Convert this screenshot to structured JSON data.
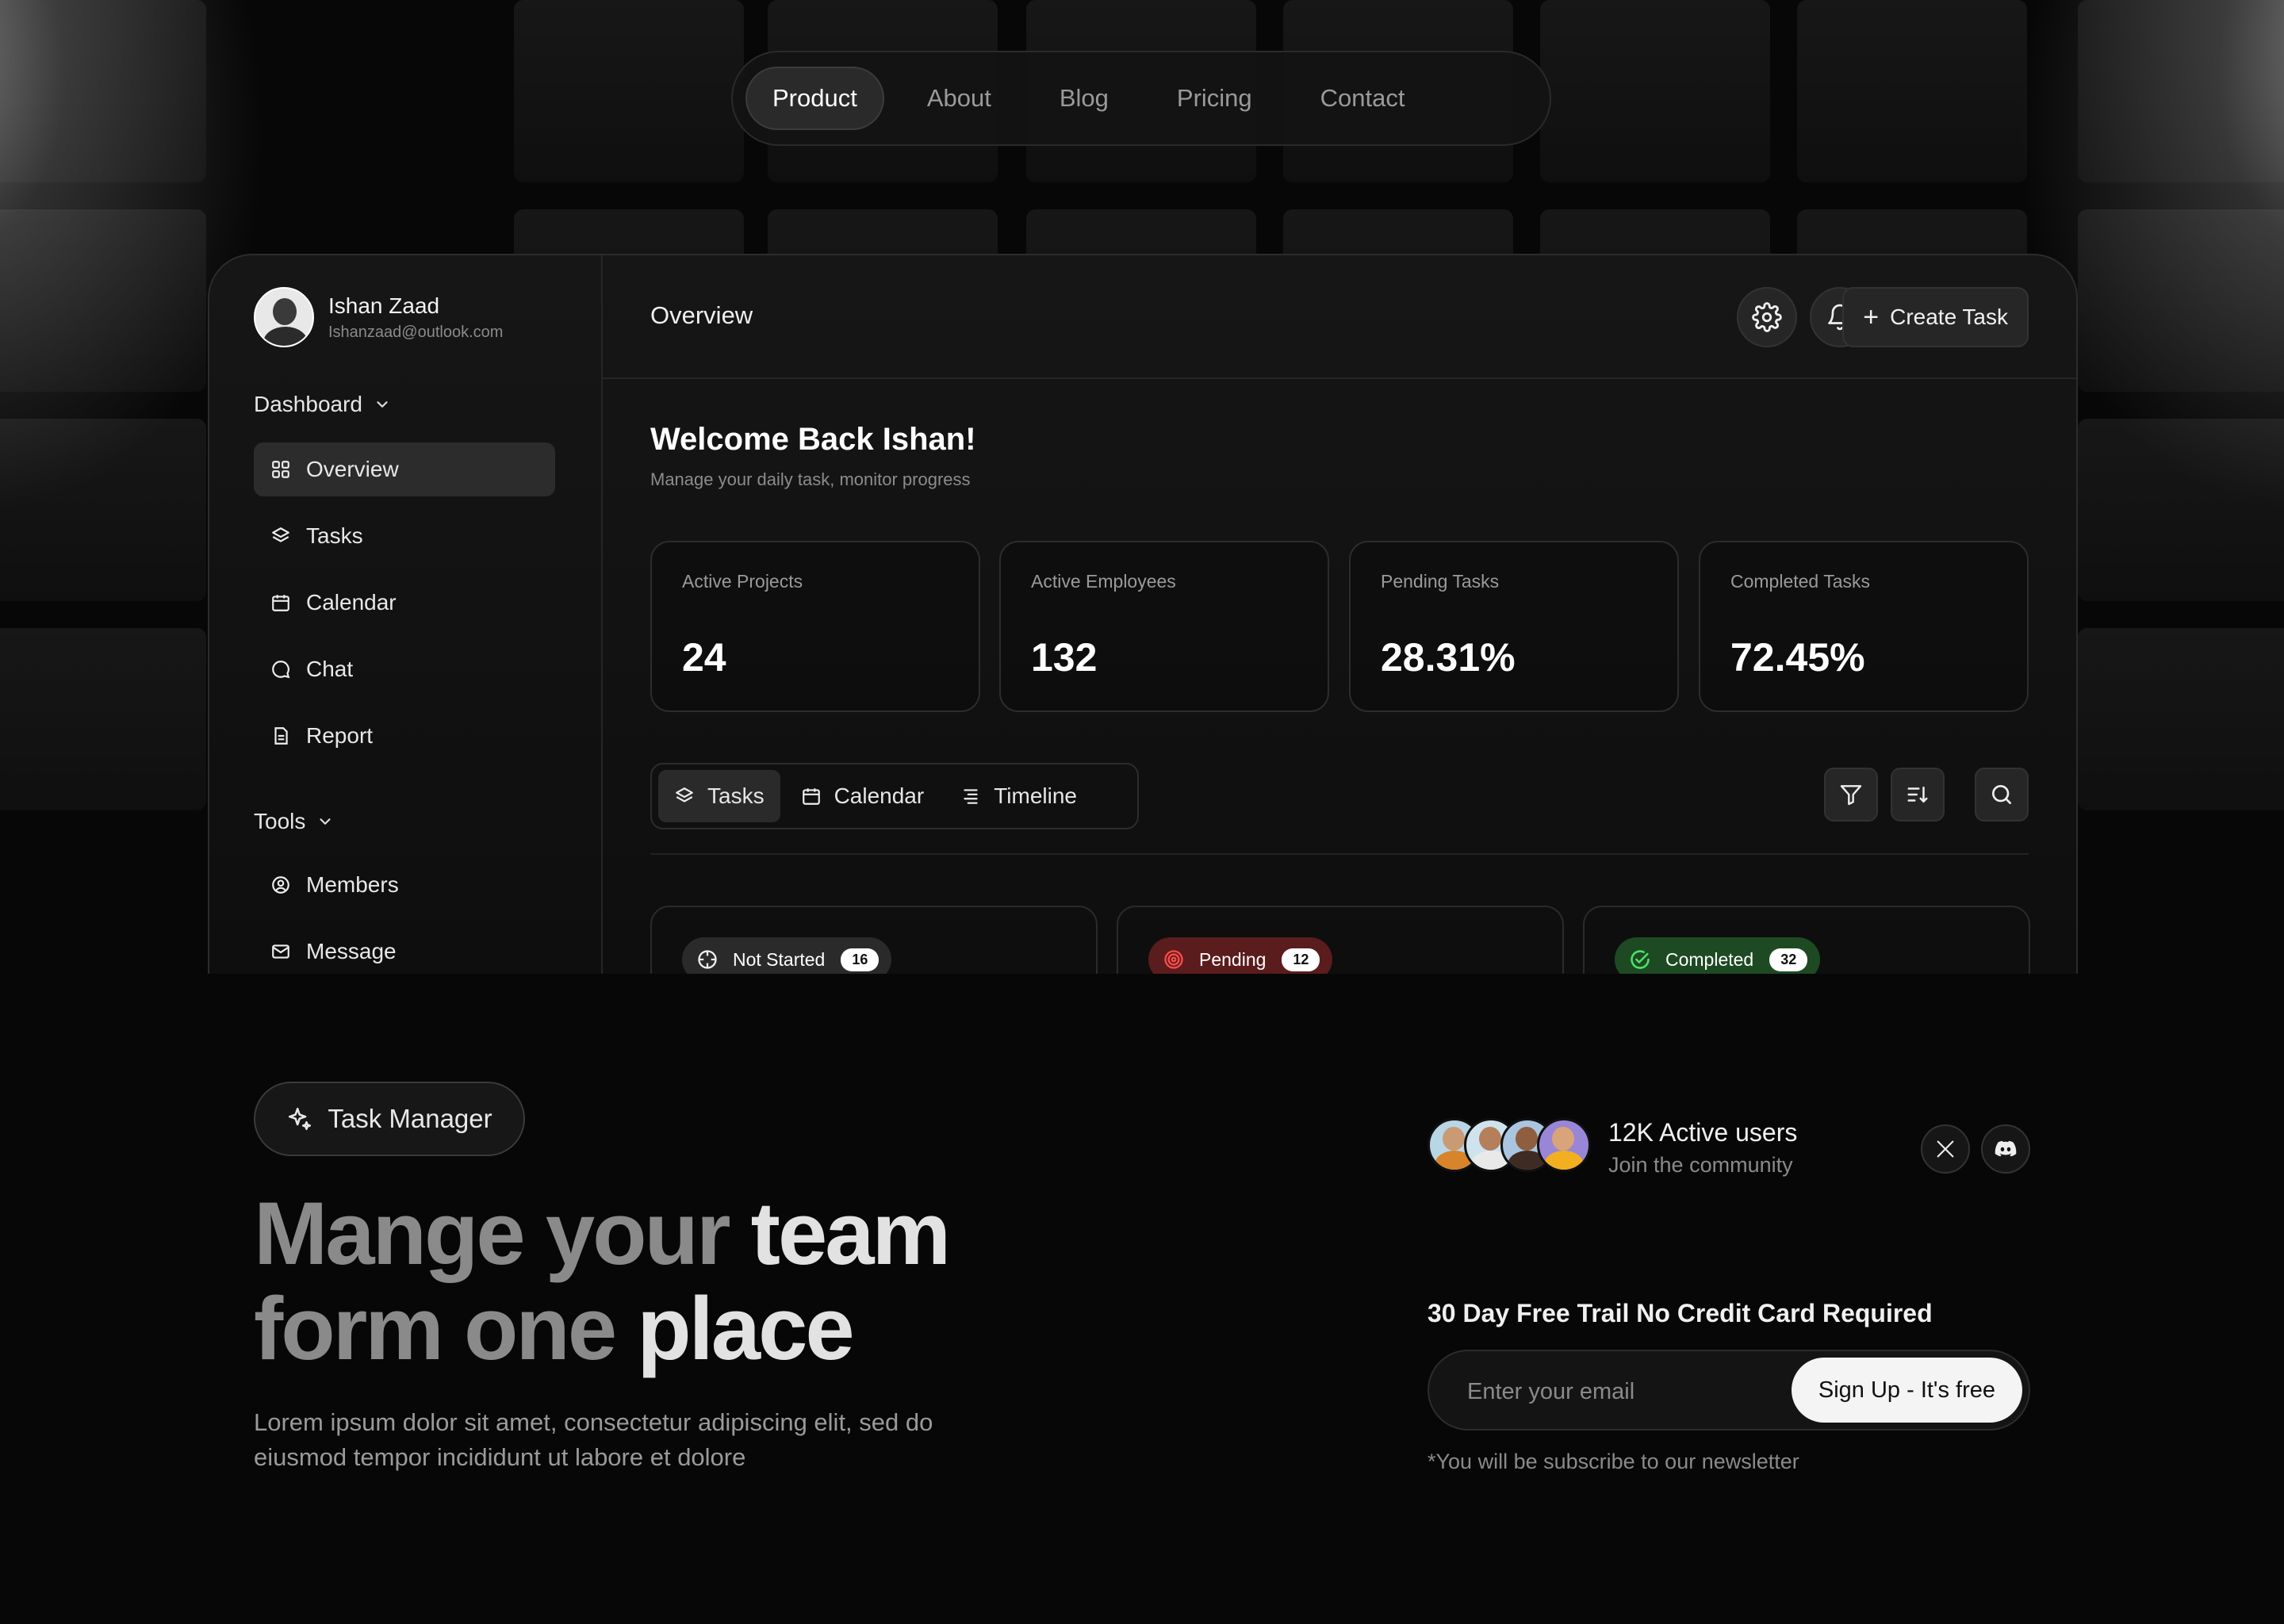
{
  "topnav": {
    "items": [
      "Product",
      "About",
      "Blog",
      "Pricing",
      "Contact"
    ],
    "active": "Product"
  },
  "user": {
    "name": "Ishan Zaad",
    "email": "Ishanzaad@outlook.com"
  },
  "sidebar": {
    "dashboard_label": "Dashboard",
    "dashboard_items": [
      {
        "label": "Overview",
        "icon": "grid-icon",
        "active": true
      },
      {
        "label": "Tasks",
        "icon": "layers-icon"
      },
      {
        "label": "Calendar",
        "icon": "calendar-icon"
      },
      {
        "label": "Chat",
        "icon": "chat-icon"
      },
      {
        "label": "Report",
        "icon": "report-icon"
      }
    ],
    "tools_label": "Tools",
    "tools_items": [
      {
        "label": "Members",
        "icon": "user-circle-icon"
      },
      {
        "label": "Message",
        "icon": "mail-icon"
      }
    ]
  },
  "header": {
    "title": "Overview",
    "create_label": "Create Task"
  },
  "welcome": {
    "title": "Welcome Back Ishan!",
    "subtitle": "Manage your daily task, monitor progress"
  },
  "stats": [
    {
      "label": "Active Projects",
      "value": "24"
    },
    {
      "label": "Active Employees",
      "value": "132"
    },
    {
      "label": "Pending Tasks",
      "value": "28.31%"
    },
    {
      "label": "Completed Tasks",
      "value": "72.45%"
    }
  ],
  "view_tabs": [
    {
      "label": "Tasks",
      "icon": "layers-icon",
      "active": true
    },
    {
      "label": "Calendar",
      "icon": "calendar-icon"
    },
    {
      "label": "Timeline",
      "icon": "list-icon"
    }
  ],
  "toolbar": {
    "icons": [
      "filter-icon",
      "sort-icon",
      "search-icon"
    ]
  },
  "columns": [
    {
      "label": "Not Started",
      "count": "16",
      "color": "#2a2a2a",
      "icon": "crosshair-icon"
    },
    {
      "label": "Pending",
      "count": "12",
      "color": "#5a1c1c",
      "icon": "target-icon"
    },
    {
      "label": "Completed",
      "count": "32",
      "color": "#1d4a22",
      "icon": "check-circle-icon"
    }
  ],
  "hero": {
    "badge": "Task Manager",
    "title_grey_1": "Mange your",
    "title_white_1": "team",
    "title_grey_2": "form one",
    "title_white_2": "place",
    "subtitle": "Lorem ipsum dolor sit amet, consectetur adipiscing elit, sed do eiusmod tempor incididunt ut labore et dolore"
  },
  "community": {
    "title": "12K Active users",
    "subtitle": "Join the community",
    "socials": [
      "x-icon",
      "discord-icon"
    ]
  },
  "signup": {
    "heading": "30 Day Free Trail No Credit Card Required",
    "placeholder": "Enter your email",
    "button": "Sign Up - It's free",
    "note": "*You will be subscribe to our newsletter"
  }
}
